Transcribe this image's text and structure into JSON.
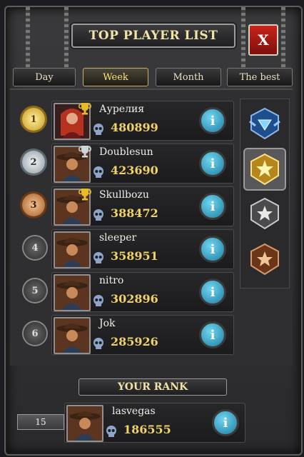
{
  "header": {
    "title": "TOP PLAYER LIST",
    "close_label": "X"
  },
  "tabs": [
    {
      "label": "Day",
      "active": false
    },
    {
      "label": "Week",
      "active": true
    },
    {
      "label": "Month",
      "active": false
    },
    {
      "label": "The best",
      "active": false
    }
  ],
  "players": [
    {
      "rank": "1",
      "name": "Аурелия",
      "score": "480899",
      "tier": "gold",
      "trophy": "gold",
      "avatar": "female"
    },
    {
      "rank": "2",
      "name": "Doublesun",
      "score": "423690",
      "tier": "silver",
      "trophy": "silver",
      "avatar": "cowboy"
    },
    {
      "rank": "3",
      "name": "Skullbozu",
      "score": "388472",
      "tier": "bronze",
      "trophy": "gold",
      "avatar": "cowboy"
    },
    {
      "rank": "4",
      "name": "sleeper",
      "score": "358951",
      "tier": "plain",
      "trophy": "",
      "avatar": "cowboy"
    },
    {
      "rank": "5",
      "name": "nitro",
      "score": "302896",
      "tier": "plain",
      "trophy": "",
      "avatar": "cowboy"
    },
    {
      "rank": "6",
      "name": "Jok",
      "score": "285926",
      "tier": "plain",
      "trophy": "",
      "avatar": "cowboy"
    }
  ],
  "info_label": "i",
  "leagues": [
    {
      "icon": "diamond-league-icon",
      "active": false
    },
    {
      "icon": "gold-league-icon",
      "active": true
    },
    {
      "icon": "silver-league-icon",
      "active": false
    },
    {
      "icon": "bronze-league-icon",
      "active": false
    }
  ],
  "your_rank": {
    "title": "YOUR RANK",
    "rank": "15",
    "name": "lasvegas",
    "score": "186555"
  },
  "colors": {
    "accent": "#f0d26a",
    "info": "#2a9cc5",
    "close": "#b81f18"
  }
}
